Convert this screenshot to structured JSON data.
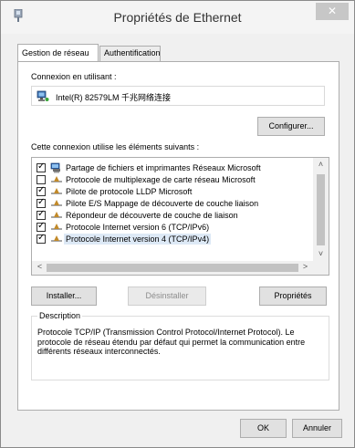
{
  "window": {
    "title": "Propriétés de Ethernet",
    "close_glyph": "✕"
  },
  "tabs": [
    {
      "label": "Gestion de réseau",
      "active": true
    },
    {
      "label": "Authentification",
      "active": false
    }
  ],
  "connection": {
    "label": "Connexion en utilisant :",
    "adapter": "Intel(R) 82579LM 千兆网络连接",
    "configure_button": "Configurer..."
  },
  "components": {
    "label": "Cette connexion utilise les éléments suivants :",
    "items": [
      {
        "label": "Partage de fichiers et imprimantes Réseaux Microsoft",
        "checked": true,
        "icon": "network-service-icon",
        "selected": false
      },
      {
        "label": "Protocole de multiplexage de carte réseau Microsoft",
        "checked": false,
        "icon": "protocol-icon",
        "selected": false
      },
      {
        "label": "Pilote de protocole LLDP Microsoft",
        "checked": true,
        "icon": "protocol-icon",
        "selected": false
      },
      {
        "label": "Pilote E/S Mappage de découverte de couche liaison",
        "checked": true,
        "icon": "protocol-icon",
        "selected": false
      },
      {
        "label": "Répondeur de découverte de couche de liaison",
        "checked": true,
        "icon": "protocol-icon",
        "selected": false
      },
      {
        "label": "Protocole Internet version 6 (TCP/IPv6)",
        "checked": true,
        "icon": "protocol-icon",
        "selected": false
      },
      {
        "label": "Protocole Internet version 4 (TCP/IPv4)",
        "checked": true,
        "icon": "protocol-icon",
        "selected": true
      }
    ],
    "install_button": "Installer...",
    "uninstall_button": "Désinstaller",
    "properties_button": "Propriétés"
  },
  "description": {
    "title": "Description",
    "text": "Protocole TCP/IP (Transmission Control Protocol/Internet Protocol). Le protocole de réseau étendu par défaut qui permet la communication entre différents réseaux interconnectés."
  },
  "footer": {
    "ok_button": "OK",
    "cancel_button": "Annuler"
  },
  "colors": {
    "selection": "#dde9f6",
    "close_button": "#c7c7c7"
  }
}
